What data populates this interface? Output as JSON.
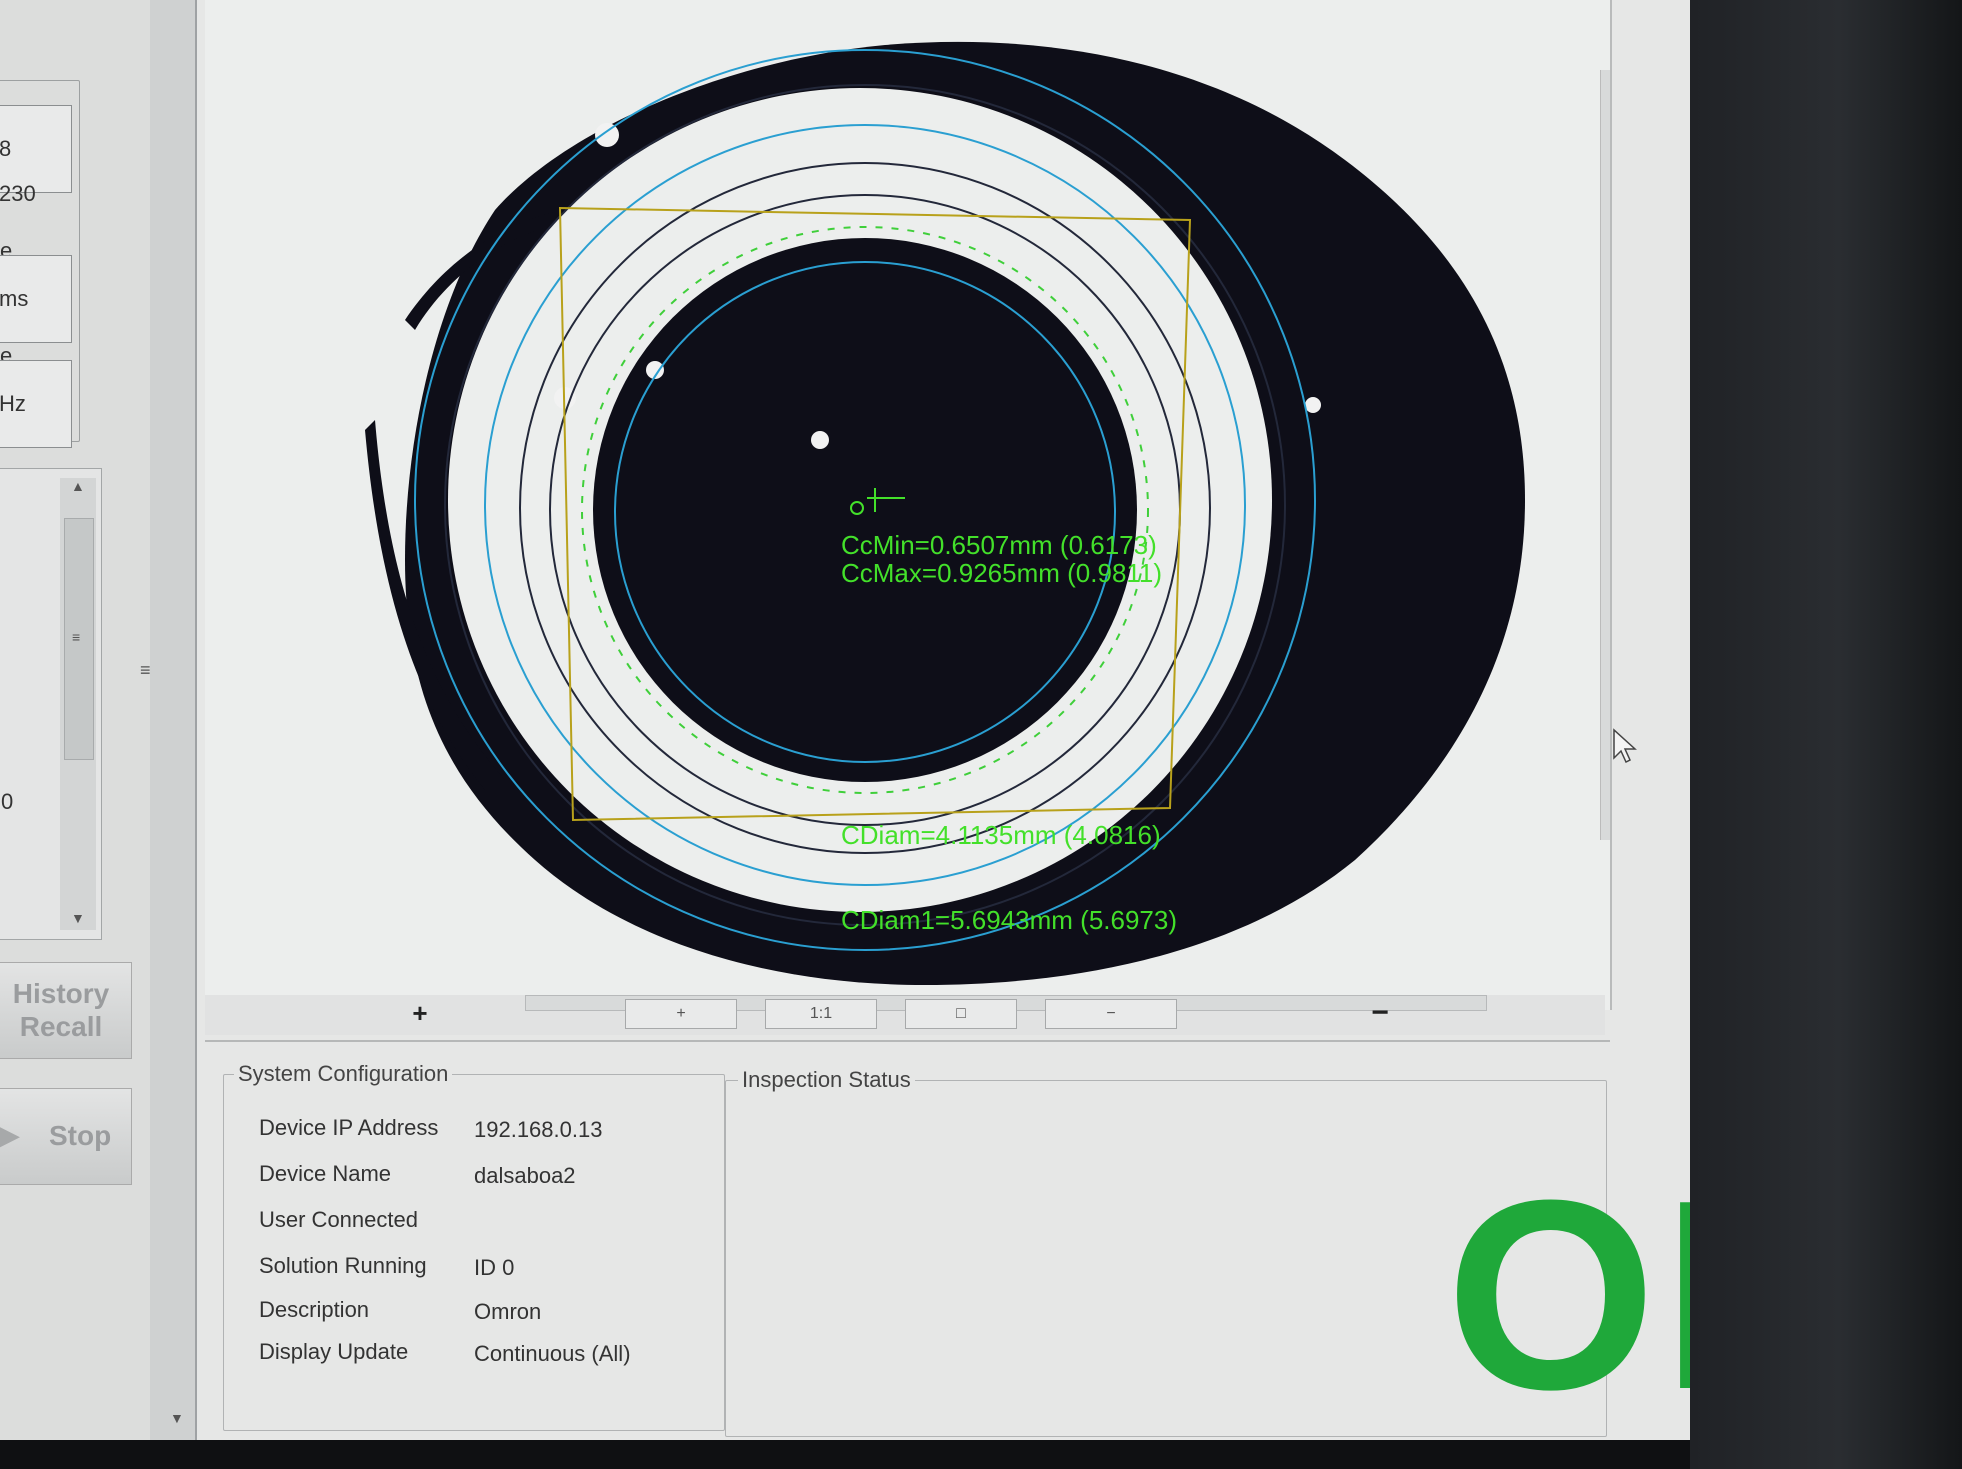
{
  "left_panel": {
    "field1_value_a": "8",
    "field1_value_b": "230",
    "field2_label": "e",
    "field2_unit": "ms",
    "field3_label": "e",
    "field3_unit": "Hz",
    "list_item": "0",
    "history_recall_label": "History Recall",
    "stop_label": "Stop"
  },
  "viewer": {
    "measurements": {
      "ccmin": "CcMin=0.6507mm (0.6173)",
      "ccmax": "CcMax=0.9265mm (0.9811)",
      "cdiam": "CDiam=4.1135mm (4.0816)",
      "cdiam1": "CDiam1=5.6943mm (5.6973)"
    },
    "toolbar": {
      "plus_label": "+",
      "zoom_in_label": "+",
      "one_to_one_label": "1:1",
      "fit_label": "□",
      "zoom_out_label": "−",
      "minus_label": "−"
    }
  },
  "system_configuration": {
    "title": "System Configuration",
    "rows": [
      {
        "label": "Device IP Address",
        "value": "192.168.0.13"
      },
      {
        "label": "Device Name",
        "value": "dalsaboa2"
      },
      {
        "label": "User Connected",
        "value": ""
      },
      {
        "label": "Solution Running",
        "value": "ID 0"
      },
      {
        "label": "Description",
        "value": "Omron"
      },
      {
        "label": "Display Update",
        "value": "Continuous (All)"
      }
    ]
  },
  "inspection_status": {
    "title": "Inspection Status",
    "result": "OK",
    "result_color": "#1fa83a"
  },
  "colors": {
    "overlay_green": "#43e02a",
    "circle_blue": "#2a9fd1",
    "roi_box": "#b8a11b",
    "edge_magenta": "#d04fd8"
  }
}
